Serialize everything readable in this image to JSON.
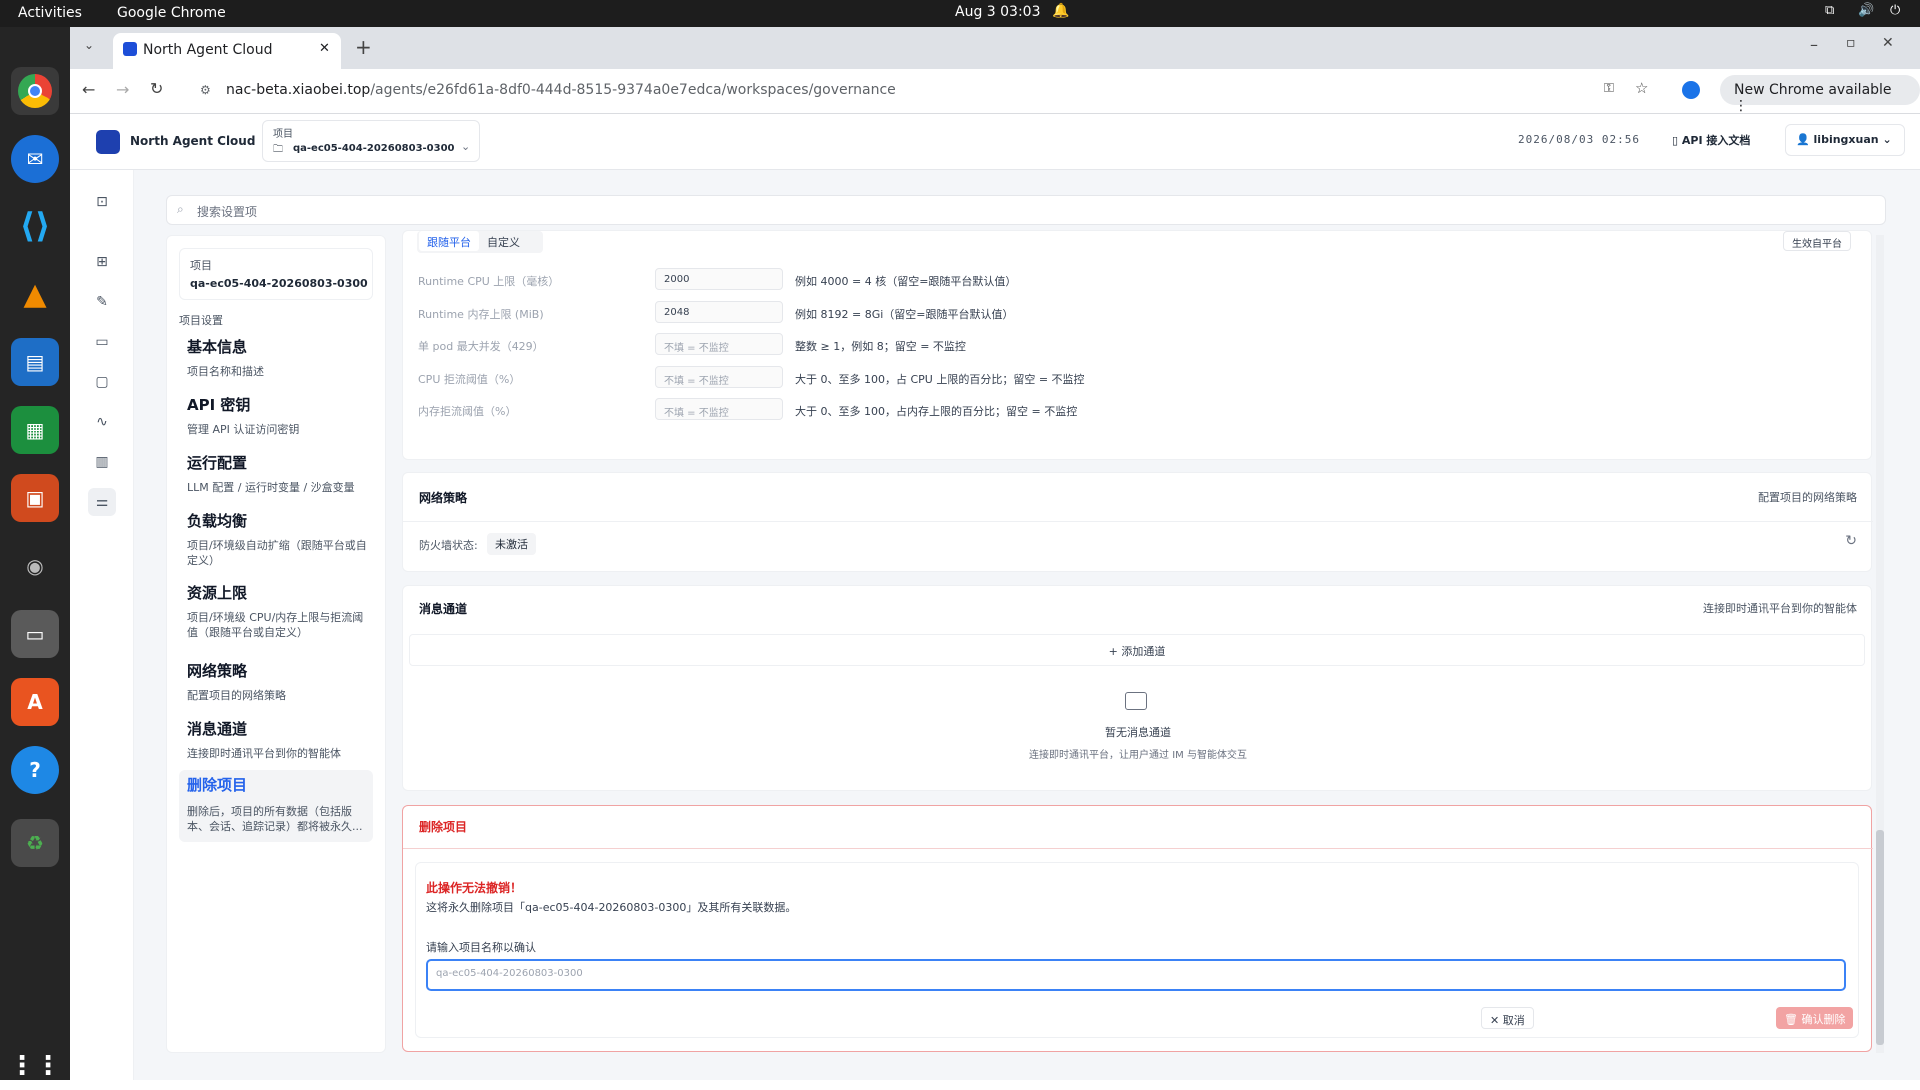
{
  "os": {
    "activities": "Activities",
    "app": "Google Chrome",
    "clock": "Aug 3  03:03"
  },
  "browser": {
    "tab_title": "North Agent Cloud",
    "url_host": "nac-beta.xiaobei.top",
    "url_path": "/agents/e26fd61a-8df0-444d-8515-9374a0e7edca/workspaces/governance",
    "update": "New Chrome available"
  },
  "header": {
    "brand": "North Agent Cloud",
    "project_label": "项目",
    "project_value": "qa-ec05-404-20260803-0300",
    "datetime": "2026/08/03 02:56",
    "api_docs": "API 接入文档",
    "user": "libingxuan"
  },
  "search": {
    "placeholder": "搜索设置项"
  },
  "sidebar": {
    "project_label": "项目",
    "project_value": "qa-ec05-404-20260803-0300",
    "section": "项目设置",
    "items": [
      {
        "title": "基本信息",
        "desc": "项目名称和描述"
      },
      {
        "title": "API 密钥",
        "desc": "管理 API 认证访问密钥"
      },
      {
        "title": "运行配置",
        "desc": "LLM 配置 / 运行时变量 / 沙盒变量"
      },
      {
        "title": "负载均衡",
        "desc": "项目/环境级自动扩缩（跟随平台或自定义）"
      },
      {
        "title": "资源上限",
        "desc": "项目/环境级 CPU/内存上限与拒流阈值（跟随平台或自定义）"
      },
      {
        "title": "网络策略",
        "desc": "配置项目的网络策略"
      },
      {
        "title": "消息通道",
        "desc": "连接即时通讯平台到你的智能体"
      },
      {
        "title": "删除项目",
        "desc": "删除后，项目的所有数据（包括版本、会话、追踪记录）都将被永久..."
      }
    ]
  },
  "resource": {
    "tab_follow": "跟随平台",
    "tab_custom": "自定义",
    "effective": "生效自平台",
    "rows": [
      {
        "label": "Runtime CPU 上限（毫核）",
        "value": "2000",
        "hint": "例如 4000 = 4 核（留空=跟随平台默认值）"
      },
      {
        "label": "Runtime 内存上限 (MiB)",
        "value": "2048",
        "hint": "例如 8192 = 8Gi（留空=跟随平台默认值）"
      },
      {
        "label": "单 pod 最大并发（429）",
        "value": "不填 = 不监控",
        "hint": "整数 ≥ 1，例如 8；留空 = 不监控"
      },
      {
        "label": "CPU 拒流阈值（%）",
        "value": "不填 = 不监控",
        "hint": "大于 0、至多 100，占 CPU 上限的百分比；留空 = 不监控"
      },
      {
        "label": "内存拒流阈值（%）",
        "value": "不填 = 不监控",
        "hint": "大于 0、至多 100，占内存上限的百分比；留空 = 不监控"
      }
    ]
  },
  "network": {
    "title": "网络策略",
    "desc": "配置项目的网络策略",
    "firewall_label": "防火墙状态:",
    "firewall_value": "未激活"
  },
  "channels": {
    "title": "消息通道",
    "desc": "连接即时通讯平台到你的智能体",
    "add": "添加通道",
    "empty_title": "暂无消息通道",
    "empty_desc": "连接即时通讯平台，让用户通过 IM 与智能体交互"
  },
  "delete": {
    "title": "删除项目",
    "warning": "此操作无法撤销！",
    "desc": "这将永久删除项目「qa-ec05-404-20260803-0300」及其所有关联数据。",
    "confirm_label": "请输入项目名称以确认",
    "placeholder": "qa-ec05-404-20260803-0300",
    "cancel": "取消",
    "confirm": "确认删除"
  },
  "colors": {
    "accent": "#2563eb",
    "danger": "#dc2626"
  }
}
